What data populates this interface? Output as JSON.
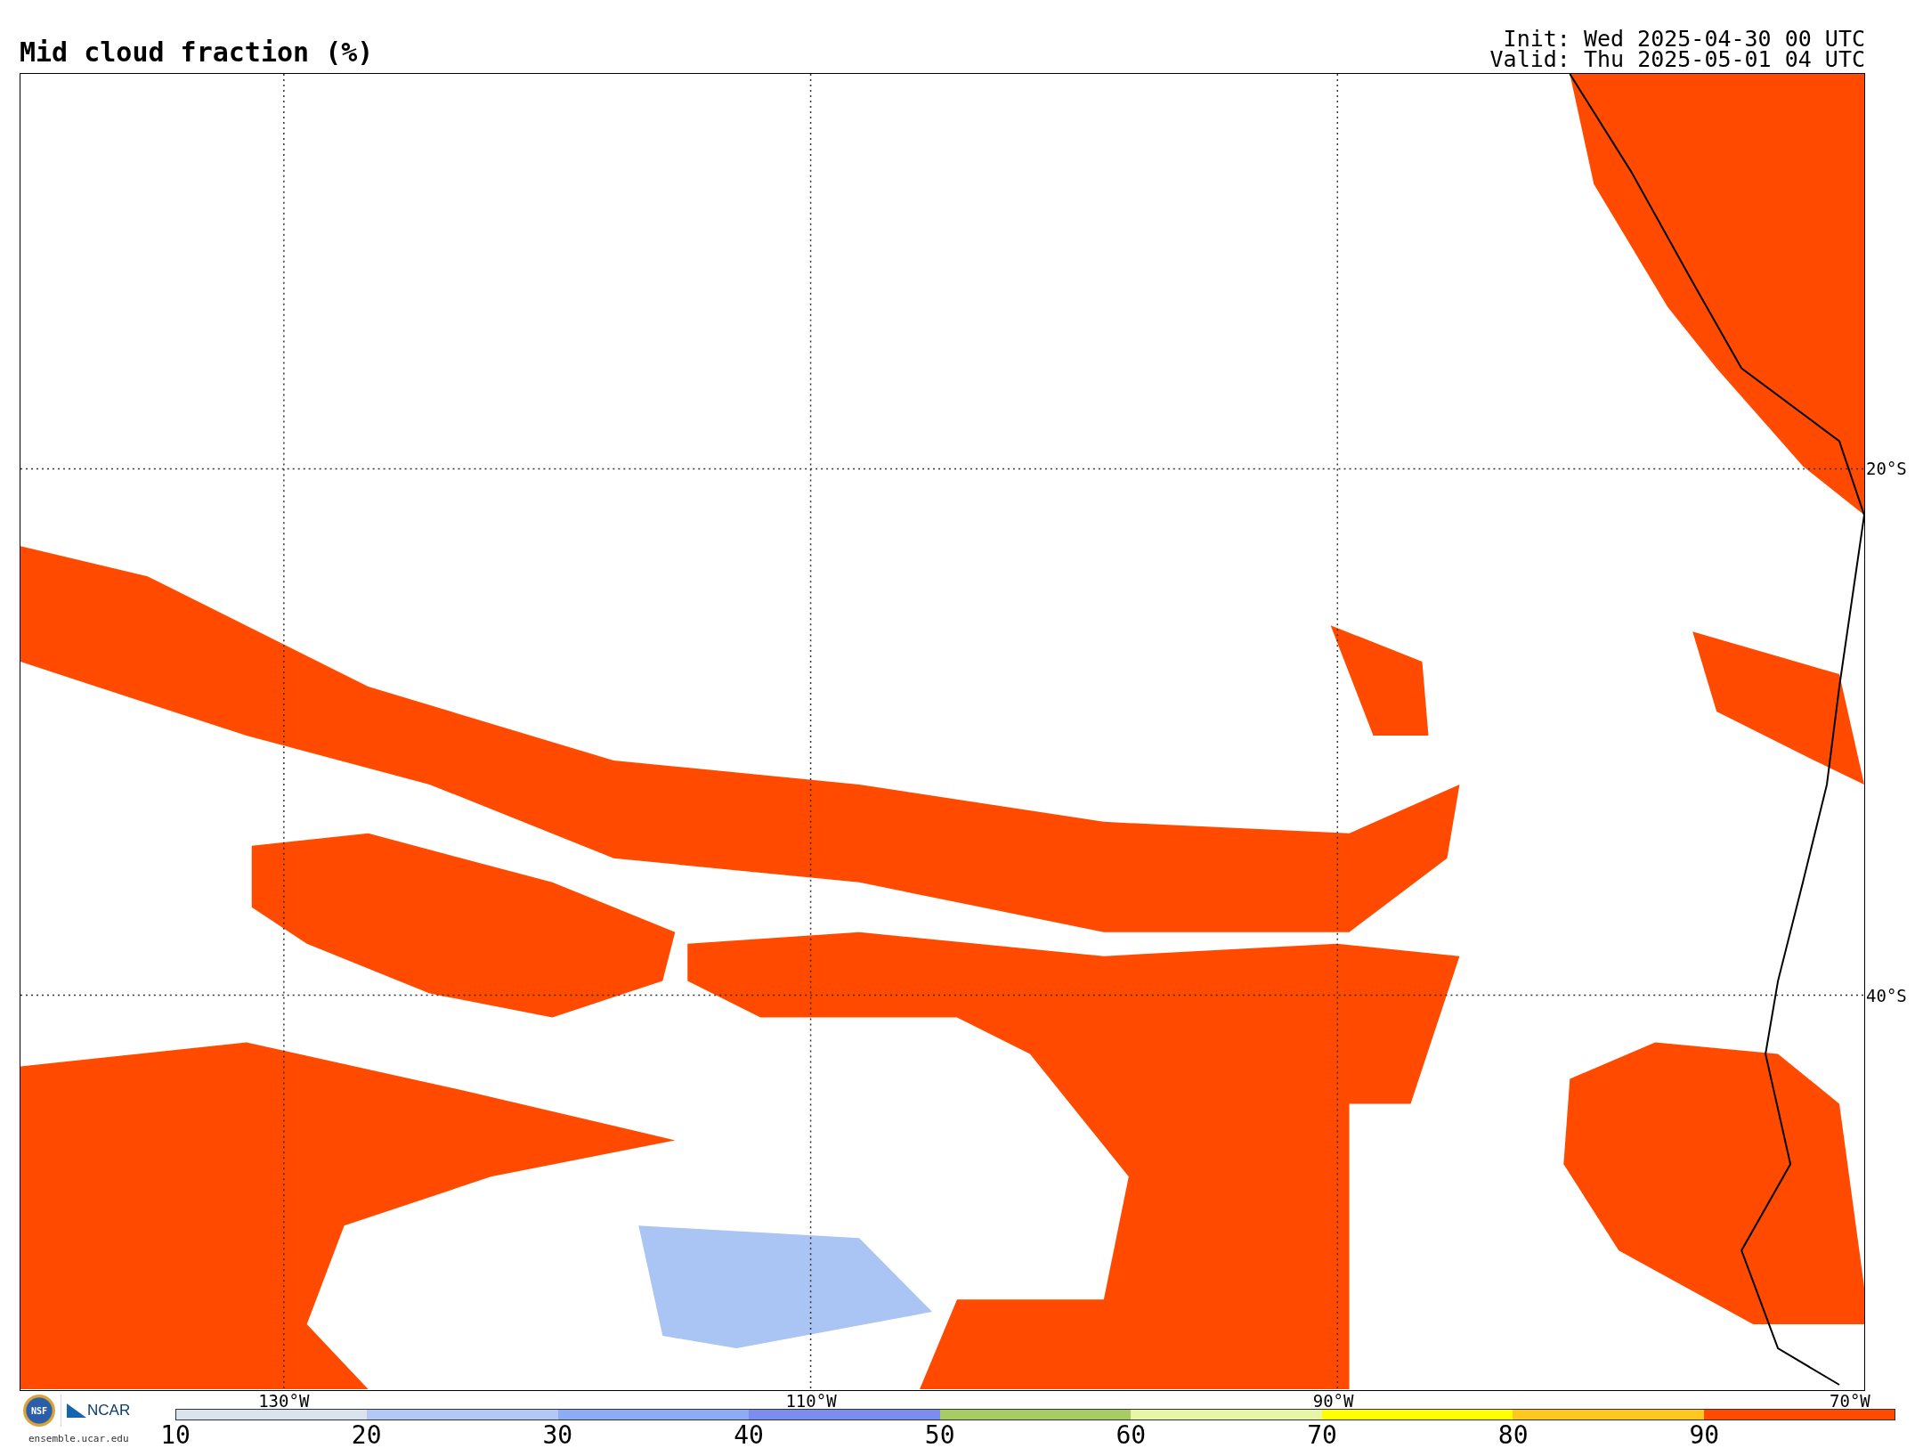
{
  "title": "Mid cloud fraction (%)",
  "init": "Init: Wed 2025-04-30 00 UTC",
  "valid": "Valid: Thu 2025-05-01 04 UTC",
  "map": {
    "longitude_labels": [
      "130°W",
      "110°W",
      "90°W",
      "70°W"
    ],
    "latitude_labels": [
      "20°S",
      "40°S"
    ]
  },
  "colorbar": {
    "segments": [
      {
        "color": "#d9e4ee"
      },
      {
        "color": "#b4c8f8"
      },
      {
        "color": "#8cacf6"
      },
      {
        "color": "#7b8ef0"
      },
      {
        "color": "#a8cc64"
      },
      {
        "color": "#e6f5a6"
      },
      {
        "color": "#ffff00"
      },
      {
        "color": "#ffc820"
      },
      {
        "color": "#ff4a00"
      }
    ],
    "ticks": [
      "10",
      "20",
      "30",
      "40",
      "50",
      "60",
      "70",
      "80",
      "90"
    ]
  },
  "logo": {
    "seal": "NSF",
    "name": "NCAR",
    "site": "ensemble.ucar.edu"
  }
}
